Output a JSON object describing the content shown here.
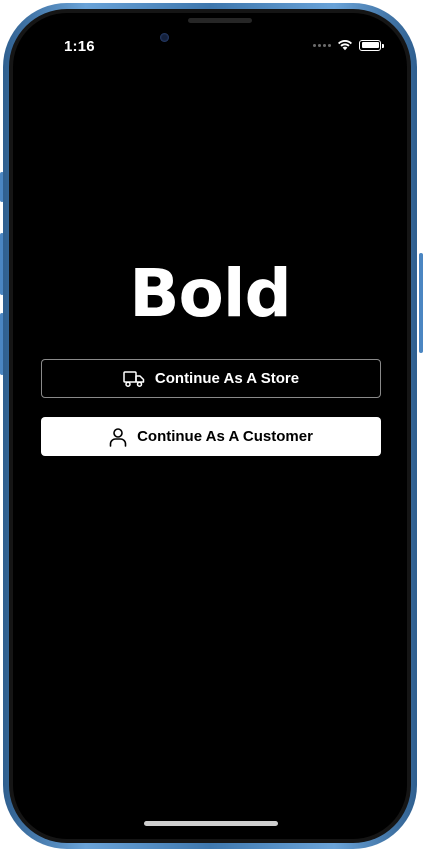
{
  "status_bar": {
    "time": "1:16",
    "icons": [
      "signal-dots-icon",
      "wifi-icon",
      "battery-icon"
    ]
  },
  "app": {
    "title": "Bold"
  },
  "buttons": {
    "store": {
      "label": "Continue As A Store",
      "icon": "truck-icon"
    },
    "customer": {
      "label": "Continue As A Customer",
      "icon": "user-icon"
    }
  },
  "colors": {
    "background": "#000000",
    "text_primary": "#ffffff",
    "button_primary_bg": "#ffffff",
    "button_primary_text": "#000000",
    "button_outline_border": "#8a8a8a",
    "device_frame": "#4b86c2"
  }
}
